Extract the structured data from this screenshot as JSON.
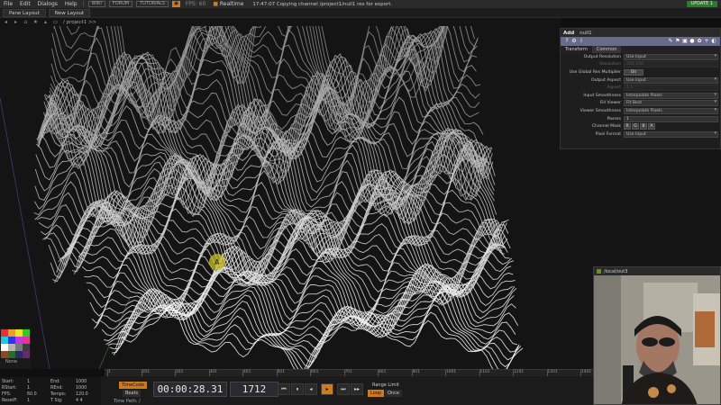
{
  "menubar": {
    "items": [
      "File",
      "Edit",
      "Dialogs",
      "Help"
    ],
    "wiki": "WIKI",
    "forum": "FORUM",
    "tutorials": "TUTORIALS",
    "fps_label": "FPS: 60",
    "realtime_label": "Realtime",
    "status": "17:47:07 Copying channel /project1/null1 res for export.",
    "update": "UPDATE 1"
  },
  "toolbar": {
    "pane_layout": "Pane Layout",
    "new_layout": "New Layout"
  },
  "pathbar": {
    "path": "/ project1 >>"
  },
  "viewport": {
    "cursor_label": "A"
  },
  "param_panel": {
    "add": "Add",
    "op_name": "null1",
    "tabs": [
      "Transform",
      "Common"
    ],
    "active_tab": "Common",
    "rows": [
      {
        "label": "Output Resolution",
        "value": "Use Input"
      },
      {
        "label": "Resolution",
        "value": "256          256",
        "dim": true
      },
      {
        "label": "Use Global Res Multiplier",
        "value": "On"
      },
      {
        "label": "Output Aspect",
        "value": "Use Input"
      },
      {
        "label": "Aspect",
        "value": "1          1",
        "dim": true
      },
      {
        "label": "Input Smoothness",
        "value": "Interpolate Pixels"
      },
      {
        "label": "Fill Viewer",
        "value": "Fit Best"
      },
      {
        "label": "Viewer Smoothness",
        "value": "Interpolate Pixels"
      },
      {
        "label": "Passes",
        "value": "1"
      },
      {
        "label": "Channel Mask",
        "value": [
          "R",
          "G",
          "B",
          "A"
        ]
      },
      {
        "label": "Pixel Format",
        "value": "Use Input"
      }
    ]
  },
  "webcam": {
    "title": "/local/out3"
  },
  "ruler": {
    "ticks": [
      "1",
      "101",
      "201",
      "301",
      "401",
      "501",
      "601",
      "701",
      "801",
      "901",
      "1001",
      "1101",
      "1201",
      "1301",
      "1401"
    ]
  },
  "palette": {
    "label": "None",
    "colors": [
      "#e83232",
      "#e8a020",
      "#e8e820",
      "#32c832",
      "#20c8e8",
      "#3232e8",
      "#c832e8",
      "#e83296",
      "#ffffff",
      "#b4b4b4",
      "#787878",
      "#3c3c3c",
      "#8b4a22",
      "#2a6a2a",
      "#2a2a6a",
      "#6a2a6a"
    ]
  },
  "stats": [
    {
      "label": "Start:",
      "value": "1"
    },
    {
      "label": "End:",
      "value": "1000"
    },
    {
      "label": "RStart:",
      "value": "1"
    },
    {
      "label": "REnd:",
      "value": "1000"
    },
    {
      "label": "FPS:",
      "value": "60.0"
    },
    {
      "label": "Tempo:",
      "value": "120.0"
    },
    {
      "label": "ResetF:",
      "value": "1"
    },
    {
      "label": "T Sig:",
      "value": "4   4"
    }
  ],
  "transport": {
    "timecode": "TimeCode",
    "beats": "Beats",
    "time": "00:00:28.31",
    "frame": "1712",
    "range_limit": "Range Limit",
    "loop": "Loop",
    "once": "Once",
    "time_path": "Time Path: /",
    "buttons": [
      "⏮",
      "⏸",
      "◂",
      "▸",
      "⏭",
      "▸▸"
    ]
  },
  "colors": {
    "accent_orange": "#d07a1e",
    "update_green": "#2d7a2d",
    "param_header": "#6a6a8c"
  }
}
